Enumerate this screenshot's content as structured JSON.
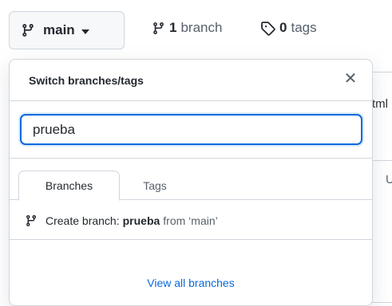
{
  "header": {
    "current_branch": "main",
    "branch_count": "1",
    "branch_word": "branch",
    "tag_count": "0",
    "tag_word": "tags"
  },
  "background": {
    "text1": "tml",
    "text2": "U"
  },
  "dropdown": {
    "title": "Switch branches/tags",
    "close_glyph": "✕",
    "search_value": "prueba",
    "tabs": [
      {
        "label": "Branches",
        "active": true
      },
      {
        "label": "Tags",
        "active": false
      }
    ],
    "create_label": "Create branch:",
    "create_name": "prueba",
    "create_from": "from ‘main’",
    "view_all": "View all branches"
  },
  "colors": {
    "accent": "#0969da",
    "border": "#d0d7de",
    "muted": "#57606a"
  }
}
